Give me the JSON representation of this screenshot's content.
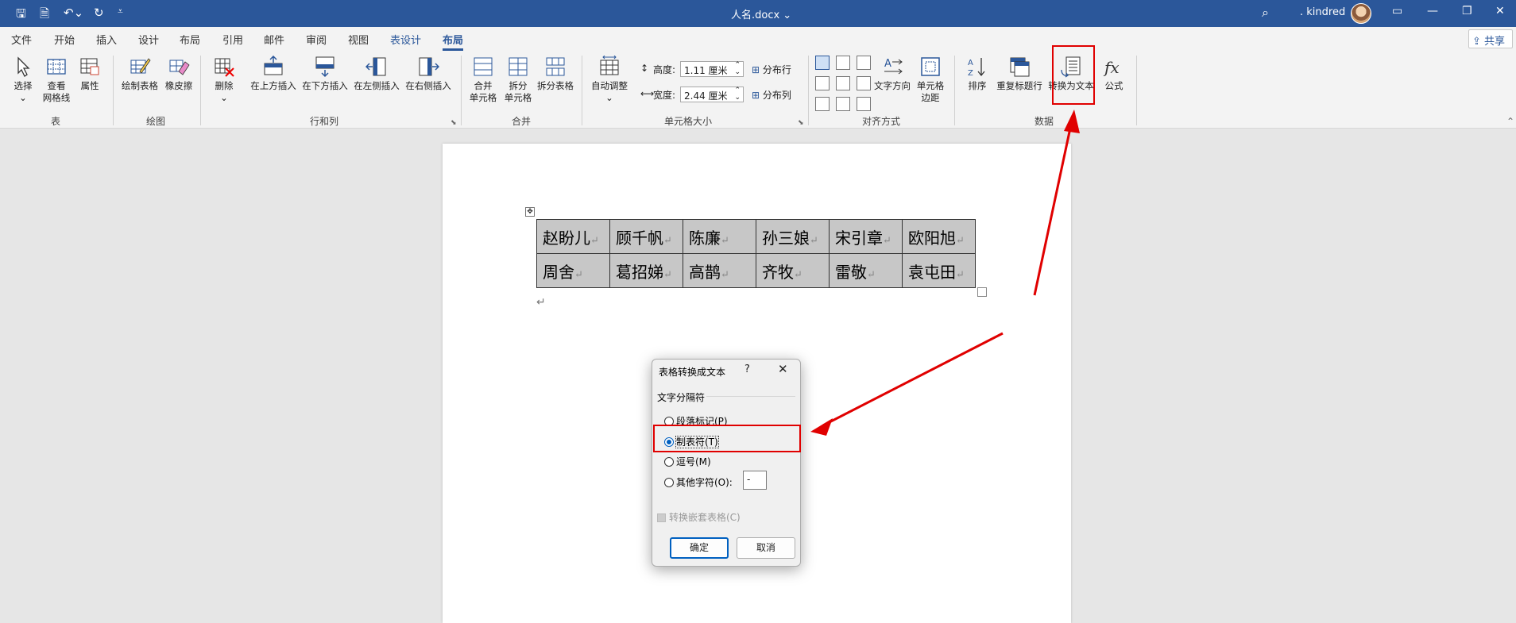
{
  "titlebar": {
    "doc_name": "人名.docx ⌄",
    "user_name": ". kindred"
  },
  "tabs": [
    "文件",
    "开始",
    "插入",
    "设计",
    "布局",
    "引用",
    "邮件",
    "审阅",
    "视图",
    "表设计",
    "布局"
  ],
  "share_label": "共享",
  "ribbon": {
    "table": {
      "select": "选择",
      "view_grid_1": "查看",
      "view_grid_2": "网格线",
      "properties": "属性",
      "group": "表"
    },
    "draw": {
      "draw_table": "绘制表格",
      "eraser": "橡皮擦",
      "group": "绘图"
    },
    "rows_cols": {
      "delete": "删除",
      "insert_above": "在上方插入",
      "insert_below": "在下方插入",
      "insert_left": "在左侧插入",
      "insert_right": "在右侧插入",
      "group": "行和列"
    },
    "merge": {
      "merge_1": "合并",
      "merge_2": "单元格",
      "split_1": "拆分",
      "split_2": "单元格",
      "split_table": "拆分表格",
      "group": "合并"
    },
    "cell_size": {
      "autofit": "自动调整",
      "height_label": "高度:",
      "height_value": "1.11 厘米",
      "width_label": "宽度:",
      "width_value": "2.44 厘米",
      "dist_rows": "分布行",
      "dist_cols": "分布列",
      "group": "单元格大小"
    },
    "alignment": {
      "text_dir": "文字方向",
      "margins_1": "单元格",
      "margins_2": "边距",
      "group": "对齐方式"
    },
    "data": {
      "sort": "排序",
      "repeat_header": "重复标题行",
      "convert_text": "转换为文本",
      "formula": "公式",
      "group": "数据"
    }
  },
  "document": {
    "rows": [
      [
        "赵盼儿",
        "顾千帆",
        "陈廉",
        "孙三娘",
        "宋引章",
        "欧阳旭"
      ],
      [
        "周舍",
        "葛招娣",
        "高鹊",
        "齐牧",
        "雷敬",
        "袁屯田"
      ]
    ],
    "cell_mark": "↵"
  },
  "dialog": {
    "title": "表格转换成文本",
    "help": "?",
    "close": "✕",
    "section": "文字分隔符",
    "options": [
      "段落标记(P)",
      "制表符(T)",
      "逗号(M)",
      "其他字符(O):"
    ],
    "selected": 1,
    "other_value": "-",
    "nested": "转换嵌套表格(C)",
    "ok": "确定",
    "cancel": "取消"
  },
  "colors": {
    "accent": "#2b579a",
    "highlight": "#e00000"
  }
}
